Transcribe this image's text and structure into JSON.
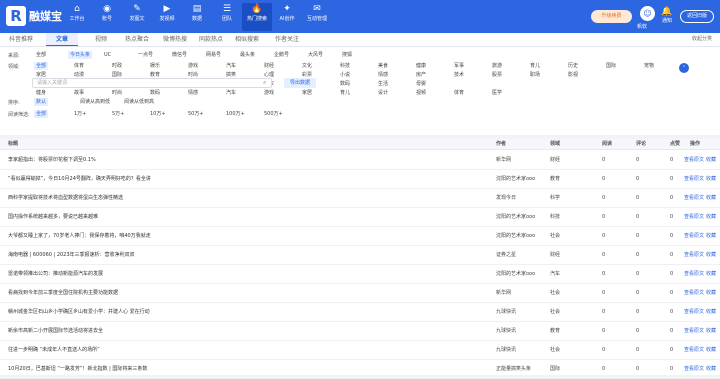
{
  "app": {
    "name": "融媒宝"
  },
  "nav": [
    {
      "label": "工作台",
      "icon": "workbench-icon"
    },
    {
      "label": "账号",
      "icon": "account-icon"
    },
    {
      "label": "发图文",
      "icon": "post-article-icon"
    },
    {
      "label": "发视频",
      "icon": "post-video-icon"
    },
    {
      "label": "数据",
      "icon": "data-icon"
    },
    {
      "label": "团队",
      "icon": "team-icon"
    },
    {
      "label": "热门搜索",
      "icon": "hot-search-icon"
    },
    {
      "label": "AI创作",
      "icon": "ai-create-icon"
    },
    {
      "label": "互动管理",
      "icon": "interaction-icon"
    }
  ],
  "header_right": {
    "upgrade": "升级续费",
    "notify": "通知",
    "tutorial": "教程",
    "service": "客服",
    "user": "帆软",
    "back": "返回旧版"
  },
  "tabs": [
    "抖音推荐",
    "文章",
    "视频",
    "热点聚合",
    "微博热搜",
    "同款热点",
    "相似搜索",
    "作者关注"
  ],
  "active_tab": 1,
  "collect": "收起分类",
  "filters": {
    "source_label": "来源:",
    "sources": [
      "全部",
      "今日头条",
      "UC",
      "一点号",
      "微信号",
      "网易号",
      "最头条",
      "企鹅号",
      "大风号",
      "搜狐"
    ],
    "field_label": "领域:",
    "fields_row1": [
      "全部",
      "体育",
      "时政",
      "娱乐",
      "游戏",
      "汽车",
      "财经",
      "文化",
      "科技",
      "美食",
      "健康",
      "军事",
      "旅游",
      "育儿",
      "历史",
      "国际",
      "宠物"
    ],
    "fields_row2": [
      "家居",
      "动漫",
      "国际",
      "教育",
      "时尚",
      "搞笑",
      "心理",
      "彩票",
      "小说",
      "情感",
      "房产",
      "技术",
      "股票",
      "职场",
      "影视"
    ],
    "fields_row3": [
      "农业",
      "新闻",
      "社会",
      "科学",
      "星座",
      "美文",
      "三农",
      "摄影",
      "数码",
      "生活",
      "母婴"
    ],
    "fields_row4": [
      "健身",
      "故事",
      "时尚",
      "数码",
      "情感",
      "汽车",
      "游戏",
      "家居",
      "育儿",
      "设计",
      "视频",
      "体育",
      "医学"
    ],
    "sort_label": "排序:",
    "sorts": [
      "默认",
      "阅读从高到低",
      "阅读从低到高"
    ],
    "read_label": "阅读筛选:",
    "reads": [
      "全部",
      "1万+",
      "5万+",
      "10万+",
      "50万+",
      "100万+",
      "500万+"
    ]
  },
  "search": {
    "placeholder": "请输入关键词",
    "export": "导出数据"
  },
  "table": {
    "headers": [
      "标题",
      "作者",
      "领域",
      "阅读",
      "评论",
      "点赞",
      "操作"
    ],
    "actions": [
      "查看原文",
      "收藏"
    ],
    "rows": [
      {
        "title": "李家超指出：将股票印花税下调至0.1%",
        "author": "新华网",
        "field": "财经",
        "read": "0",
        "comment": "0",
        "like": "0"
      },
      {
        "title": "“看似赢得输掉”，今日10月24号翻阵，确天弄明好吃的？看全讲",
        "author": "沈阳的艺术家ooo",
        "field": "教育",
        "read": "0",
        "comment": "0",
        "like": "0"
      },
      {
        "title": "西科学家提取将技术将血型数据将蛋白生态弹性精选",
        "author": "发现今日",
        "field": "科学",
        "read": "0",
        "comment": "0",
        "like": "0"
      },
      {
        "title": "国内操作系统越来越多，要说已越来越难",
        "author": "沈阳的艺术家ooo",
        "field": "科技",
        "read": "0",
        "comment": "0",
        "like": "0"
      },
      {
        "title": "大爷都又睡上家了，70岁老人捧门：我保存着将，咱40万我就走",
        "author": "沈阳的艺术家ooo",
        "field": "社会",
        "read": "0",
        "comment": "0",
        "like": "0"
      },
      {
        "title": "海南电器 | 600060 | 2023年三季报速析：营收净利双双",
        "author": "证券之星",
        "field": "财经",
        "read": "0",
        "comment": "0",
        "like": "0"
      },
      {
        "title": "雷诺带领推出公司：推动新能源汽车的发展",
        "author": "沈阳的艺术家ooo",
        "field": "汽车",
        "read": "0",
        "comment": "0",
        "like": "0"
      },
      {
        "title": "看病找到今年前三季度全国住院机构主要功能数据",
        "author": "新华网",
        "field": "社会",
        "read": "0",
        "comment": "0",
        "like": "0"
      },
      {
        "title": "赣州城金华区石山乡小学确区乡山有爱小学：并建人心 爱在行动",
        "author": "九球快讯",
        "field": "社会",
        "read": "0",
        "comment": "0",
        "like": "0"
      },
      {
        "title": "新余市高新二小开展国际节选活动将进去全",
        "author": "九球快讯",
        "field": "教育",
        "read": "0",
        "comment": "0",
        "like": "0"
      },
      {
        "title": "往进一步明确 “未成年人不直送人的场所”",
        "author": "九球快讯",
        "field": "社会",
        "read": "0",
        "comment": "0",
        "like": "0"
      },
      {
        "title": "10月20日，巴基斯坦 “一路发芳”！新北指数 | 国际将来三条数",
        "author": "正能量搞笑头条",
        "field": "国际",
        "read": "0",
        "comment": "0",
        "like": "0"
      }
    ]
  }
}
